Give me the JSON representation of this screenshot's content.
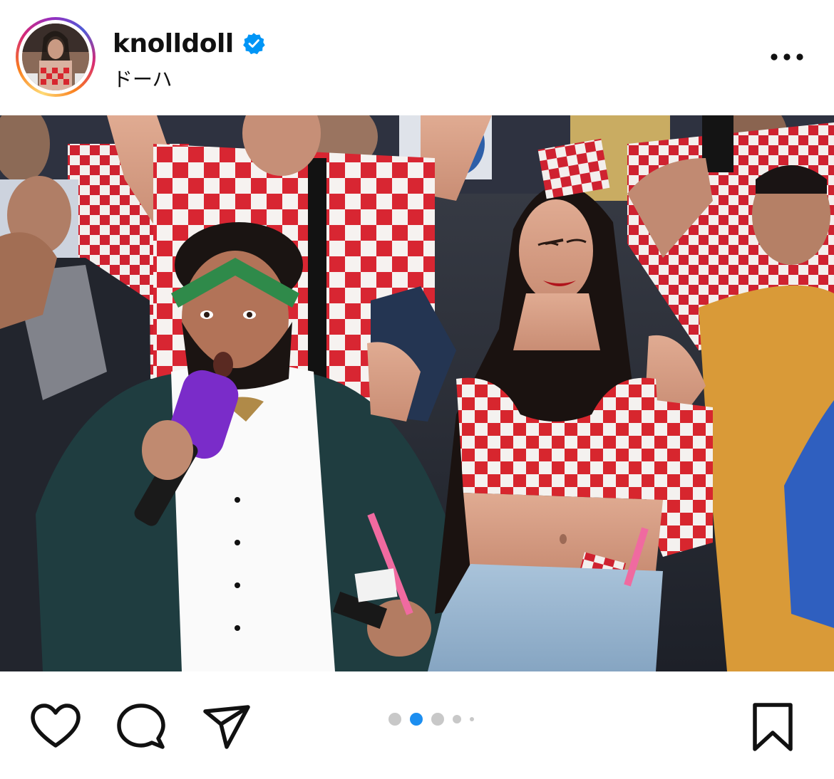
{
  "post": {
    "username": "knolldoll",
    "verified": true,
    "location": "ドーハ"
  },
  "carousel": {
    "count": 5,
    "active_index": 1
  },
  "icons": {
    "like": "heart-icon",
    "comment": "comment-icon",
    "share": "paper-plane-icon",
    "save": "bookmark-icon",
    "more": "more-options-icon",
    "verified": "verified-badge-icon"
  },
  "colors": {
    "verified_blue": "#0095f6",
    "active_dot": "#1c8ef0",
    "inactive_dot": "#c8c8c8",
    "checker_red": "#d7262e"
  }
}
